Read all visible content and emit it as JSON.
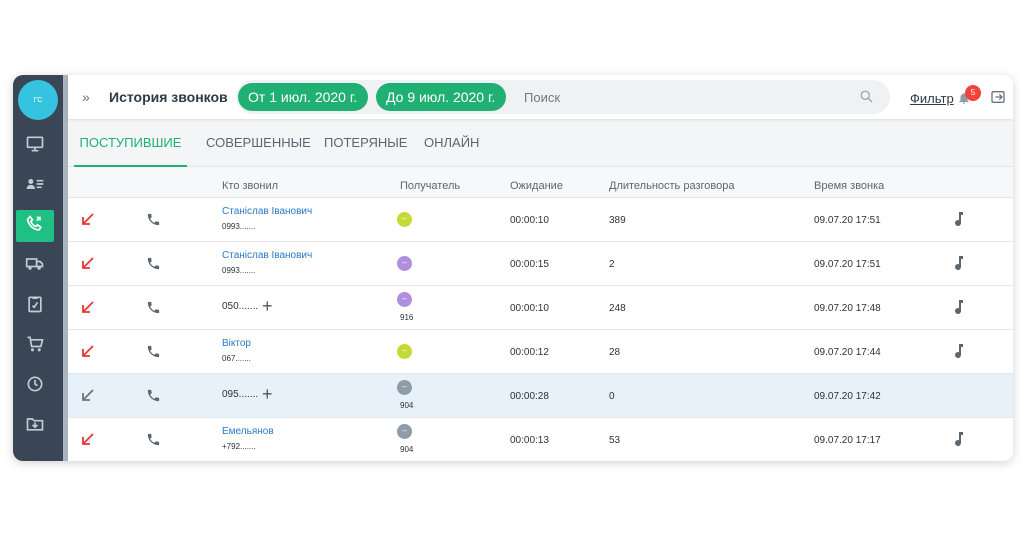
{
  "sidebar": {
    "avatar_initials": "ГС",
    "items": [
      {
        "icon": "monitor-icon"
      },
      {
        "icon": "contacts-icon"
      },
      {
        "icon": "phone-calls-icon",
        "active": true
      },
      {
        "icon": "truck-icon"
      },
      {
        "icon": "clipboard-icon"
      },
      {
        "icon": "cart-icon"
      },
      {
        "icon": "history-icon"
      },
      {
        "icon": "folder-download-icon"
      }
    ]
  },
  "header": {
    "expand_icon": "»",
    "title": "История звонков",
    "date_from": "От 1 июл. 2020 г.",
    "date_to": "До 9 июл. 2020 г.",
    "search_placeholder": "Поиск",
    "filter_label": "Фильтр",
    "notifications_count": "5"
  },
  "tabs": [
    {
      "label": "ПОСТУПИВШИЕ",
      "active": true
    },
    {
      "label": "СОВЕРШЕННЫЕ"
    },
    {
      "label": "ПОТЕРЯНЫЕ"
    },
    {
      "label": "ОНЛАЙН"
    }
  ],
  "columns": {
    "caller": "Кто звонил",
    "recipient": "Получатель",
    "waiting": "Ожидание",
    "duration": "Длительность разговора",
    "time": "Время звонка"
  },
  "colors": {
    "accent": "#20b074",
    "missed_arrow": "#e53935",
    "answered_arrow": "#6b7580",
    "link": "#2979c5"
  },
  "rows": [
    {
      "arrow": "red",
      "caller_name": "Станіслав Іванович",
      "caller_number": "0993.......",
      "recipient_color": "#c6da36",
      "recipient_mark": "–",
      "recipient_ext": "",
      "waiting": "00:00:10",
      "duration": "389",
      "time": "09.07.20 17:51",
      "recording": true,
      "highlight": false,
      "add": false
    },
    {
      "arrow": "red",
      "caller_name": "Станіслав Іванович",
      "caller_number": "0993.......",
      "recipient_color": "#b08fe0",
      "recipient_mark": "–",
      "recipient_ext": "",
      "waiting": "00:00:15",
      "duration": "2",
      "time": "09.07.20 17:51",
      "recording": true,
      "highlight": false,
      "add": false
    },
    {
      "arrow": "red",
      "caller_name": "",
      "caller_number": "050.......",
      "recipient_color": "#b08fe0",
      "recipient_mark": "–",
      "recipient_ext": "916",
      "waiting": "00:00:10",
      "duration": "248",
      "time": "09.07.20 17:48",
      "recording": true,
      "highlight": false,
      "add": true
    },
    {
      "arrow": "red",
      "caller_name": "Віктор",
      "caller_number": "067.......",
      "recipient_color": "#c6da36",
      "recipient_mark": "–",
      "recipient_ext": "",
      "waiting": "00:00:12",
      "duration": "28",
      "time": "09.07.20 17:44",
      "recording": true,
      "highlight": false,
      "add": false
    },
    {
      "arrow": "gray",
      "caller_name": "",
      "caller_number": "095.......",
      "recipient_color": "#8f9ba6",
      "recipient_mark": "–",
      "recipient_ext": "904",
      "waiting": "00:00:28",
      "duration": "0",
      "time": "09.07.20 17:42",
      "recording": false,
      "highlight": true,
      "add": true
    },
    {
      "arrow": "red",
      "caller_name": "Емельянов",
      "caller_number": "+792.......",
      "recipient_color": "#8f9ba6",
      "recipient_mark": "–",
      "recipient_ext": "904",
      "waiting": "00:00:13",
      "duration": "53",
      "time": "09.07.20 17:17",
      "recording": true,
      "highlight": false,
      "add": false
    }
  ]
}
